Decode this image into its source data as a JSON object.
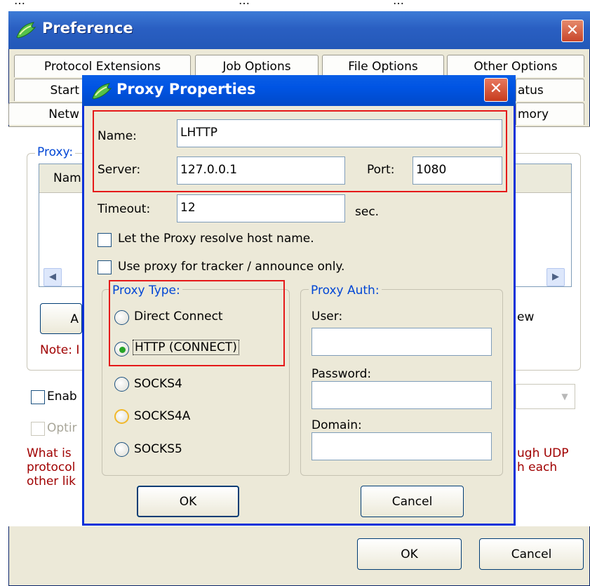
{
  "background_strip": [
    "…",
    "…",
    "…"
  ],
  "preference": {
    "title": "Preference",
    "tabs_row1": [
      "Protocol Extensions",
      "Job Options",
      "File Options",
      "Other Options"
    ],
    "tabs_row2": [
      "Start",
      "atus"
    ],
    "tabs_row3": [
      "Netw",
      "mory"
    ],
    "proxy_group_label": "Proxy:",
    "list_header_name": "Nam",
    "add_button_label": "A",
    "right_button_label": "ew",
    "note_text": "Note: I",
    "enable_label": "Enab",
    "option_label": "Optir",
    "help_text_left": [
      "What is",
      "protocol",
      "other lik"
    ],
    "help_text_right": [
      "ugh UDP",
      "h each"
    ],
    "ok_label": "OK",
    "cancel_label": "Cancel"
  },
  "proxy_dialog": {
    "title": "Proxy Properties",
    "name_label": "Name:",
    "name_value": "LHTTP",
    "server_label": "Server:",
    "server_value": "127.0.0.1",
    "port_label": "Port:",
    "port_value": "1080",
    "timeout_label": "Timeout:",
    "timeout_value": "12",
    "timeout_unit": "sec.",
    "resolve_host_label": "Let the Proxy resolve host name.",
    "resolve_host_checked": false,
    "tracker_only_label": "Use proxy for tracker / announce only.",
    "tracker_only_checked": false,
    "proxy_type_label": "Proxy Type:",
    "proxy_types": [
      "Direct Connect",
      "HTTP (CONNECT)",
      "SOCKS4",
      "SOCKS4A",
      "SOCKS5"
    ],
    "selected_proxy_type": "HTTP (CONNECT)",
    "proxy_auth_label": "Proxy Auth:",
    "user_label": "User:",
    "user_value": "",
    "password_label": "Password:",
    "password_value": "",
    "domain_label": "Domain:",
    "domain_value": "",
    "ok_label": "OK",
    "cancel_label": "Cancel"
  },
  "colors": {
    "title_bar_blue": "#0054e3",
    "window_face": "#ece9d8",
    "highlight_red": "#e51919",
    "groupbox_label_blue": "#0046d5",
    "note_red": "#a00000"
  }
}
